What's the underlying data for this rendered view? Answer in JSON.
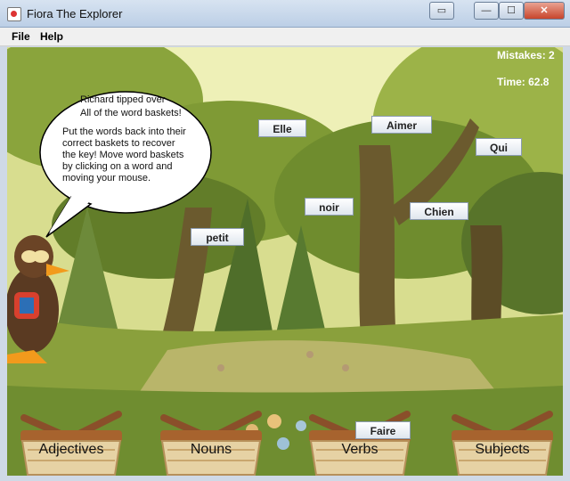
{
  "window": {
    "title": "Fiora The Explorer",
    "min_glyph": "—",
    "max_glyph": "☐",
    "close_glyph": "✕",
    "restore_glyph": "▭"
  },
  "menu": {
    "items": [
      "File",
      "Help"
    ]
  },
  "hud": {
    "mistakes": "Mistakes: 2",
    "time": "Time: 62.8"
  },
  "speech": {
    "line1": "Richard tipped over",
    "line2": "All of the word baskets!",
    "body": [
      "Put the words back into their",
      "correct baskets to recover",
      "the key! Move word baskets",
      "by clicking on a word and",
      "moving your mouse."
    ]
  },
  "words": [
    "Elle",
    "Aimer",
    "Qui",
    "noir",
    "Chien",
    "petit",
    "Faire"
  ],
  "baskets": [
    "Adjectives",
    "Nouns",
    "Verbs",
    "Subjects"
  ],
  "colors": {
    "tree_trunk": "#6b5a2e",
    "foliage_dark": "#5f7a2a",
    "foliage_light": "#a9bf56",
    "basket": "#e6d2a4",
    "basket_handle": "#8a4f2a"
  }
}
